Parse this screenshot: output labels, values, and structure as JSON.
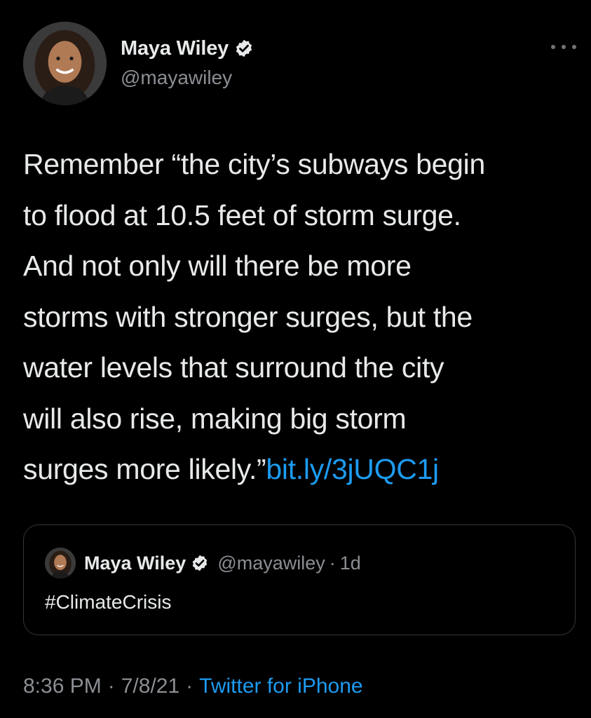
{
  "author": {
    "display_name": "Maya Wiley",
    "handle": "@mayawiley",
    "verified": true
  },
  "tweet": {
    "lines": [
      "Remember “the city’s subways begin",
      "to flood at 10.5 feet of storm surge.",
      "And not only will there be more",
      "storms with stronger surges, but the",
      "water levels that surround the city",
      "will also rise, making big storm",
      "surges more likely.”"
    ],
    "link": "bit.ly/3jUQC1j"
  },
  "quoted_tweet": {
    "display_name": "Maya Wiley",
    "handle": "@mayawiley",
    "separator": "·",
    "age": "1d",
    "text": "#ClimateCrisis"
  },
  "meta": {
    "time": "8:36 PM",
    "date": "7/8/21",
    "separator": "·",
    "source": "Twitter for iPhone"
  },
  "colors": {
    "background": "#000000",
    "link": "#1d9bf0",
    "muted": "#8b8e93",
    "border": "#333639"
  },
  "icons": {
    "verified": "verified-badge-icon",
    "more": "more-horizontal-icon"
  }
}
